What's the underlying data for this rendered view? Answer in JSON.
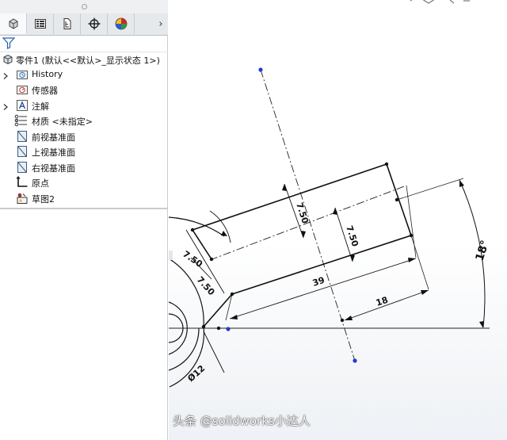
{
  "feature_tree": {
    "root_label": "零件1 (默认<<默认>_显示状态 1>)",
    "items": [
      {
        "label": "History",
        "icon": "history-folder-icon",
        "expandable": true
      },
      {
        "label": "传感器",
        "icon": "sensor-icon",
        "expandable": false
      },
      {
        "label": "注解",
        "icon": "annotation-icon",
        "expandable": true
      },
      {
        "label": "材质 <未指定>",
        "icon": "material-icon",
        "expandable": false
      },
      {
        "label": "前视基准面",
        "icon": "plane-icon",
        "expandable": false
      },
      {
        "label": "上视基准面",
        "icon": "plane-icon",
        "expandable": false
      },
      {
        "label": "右视基准面",
        "icon": "plane-icon",
        "expandable": false
      },
      {
        "label": "原点",
        "icon": "origin-icon",
        "expandable": false
      },
      {
        "label": "草图2",
        "icon": "sketch-icon",
        "expandable": false
      }
    ]
  },
  "tabs": [
    "featuremanager-tab",
    "propertymanager-tab",
    "configurationmanager-tab",
    "dimxpert-tab",
    "display-manager-tab"
  ],
  "sketch": {
    "dimensions": {
      "upper_offset": "7.50",
      "lower_offset": "7.50",
      "left_offset_a": "7.50",
      "left_offset_b": "7.50",
      "length_total": "39",
      "length_partial": "18",
      "angle": "18°",
      "diameter": "Ø12"
    }
  },
  "watermark": "头条 @solidworks小达人"
}
